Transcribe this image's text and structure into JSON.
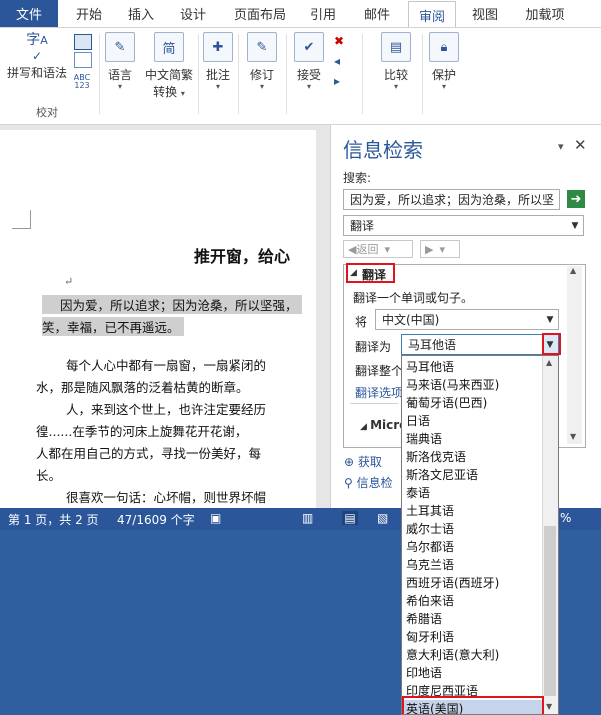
{
  "tabs": {
    "file": "文件",
    "items": [
      "开始",
      "插入",
      "设计",
      "页面布局",
      "引用",
      "邮件",
      "审阅",
      "视图",
      "加载项"
    ],
    "active": "审阅"
  },
  "ribbon": {
    "spell_label": "拼写和语法",
    "proofing_group": "校对",
    "language_label": "语言",
    "chinese_convert_label1": "中文简繁",
    "chinese_convert_label2": "转换",
    "comment_label": "批注",
    "revision_label": "修订",
    "accept_label": "接受",
    "compare_label": "比较",
    "protect_label": "保护",
    "abc_label": "ABC",
    "abc_num": "123",
    "zi_label": "字",
    "fan_label": "简"
  },
  "document": {
    "title": "推开窗，给心",
    "return_mark": "↵",
    "hl_line1": "因为爱，所以追求；因为沧桑，所以坚强，",
    "hl_line2": "笑，幸福，已不再遥远。",
    "p1_line1": "每个人心中都有一扇窗，一扇紧闭的",
    "p1_line2": "水，那是随风飘落的泛着枯黄的断章。",
    "p2_line1": "人，来到这个世上，也许注定要经历",
    "p2_line2": "徨......在季节的河床上旋舞花开花谢，",
    "p2_line3": "人都在用自己的方式，寻找一份美好，每",
    "p2_line4": "长。",
    "p3_line1": "很喜欢一句话：心坏帽，则世界坏帽"
  },
  "research_pane": {
    "title": "信息检索",
    "search_label": "搜索:",
    "search_value": "因为爱，所以追求；因为沧桑，所以坚",
    "service_value": "翻译",
    "back_label": "返回",
    "section_label": "翻译",
    "desc": "翻译一个单词或句子。",
    "from_label": "将",
    "from_value": "中文(中国)",
    "to_label": "翻译为",
    "to_value": "马耳他语",
    "translate_whole": "翻译整个",
    "translate_options": "翻译选项",
    "micro": "Micro",
    "get_label": "获取",
    "info_label": "信息检"
  },
  "status": {
    "page": "第 1 页，共 2 页",
    "words": "47/1609 个字",
    "zoom_tail": "%"
  },
  "dropdown": {
    "options": [
      "马耳他语",
      "马来语(马来西亚)",
      "葡萄牙语(巴西)",
      "日语",
      "瑞典语",
      "斯洛伐克语",
      "斯洛文尼亚语",
      "泰语",
      "土耳其语",
      "威尔士语",
      "乌尔都语",
      "乌克兰语",
      "西班牙语(西班牙)",
      "希伯来语",
      "希腊语",
      "匈牙利语",
      "意大利语(意大利)",
      "印地语",
      "印度尼西亚语",
      "英语(美国)"
    ],
    "selected": "英语(美国)"
  },
  "colors": {
    "brand_blue": "#2b579a",
    "highlight_red": "#e0141e",
    "selection": "#c5d4ea"
  }
}
